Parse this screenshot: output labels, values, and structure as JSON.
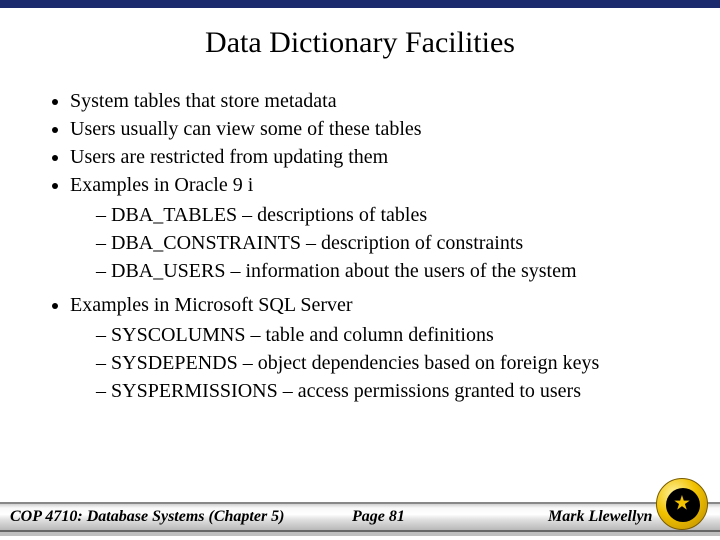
{
  "title": "Data Dictionary Facilities",
  "bullets": [
    {
      "text": "System tables that store metadata"
    },
    {
      "text": "Users usually can view some of these tables"
    },
    {
      "text": "Users are restricted from updating them"
    },
    {
      "text": "Examples in Oracle 9 i",
      "sub": [
        "DBA_TABLES – descriptions of tables",
        "DBA_CONSTRAINTS – description of constraints",
        "DBA_USERS – information about the users of the system"
      ]
    },
    {
      "text": "Examples in Microsoft SQL Server",
      "sub": [
        "SYSCOLUMNS – table and column definitions",
        "SYSDEPENDS – object dependencies based on foreign keys",
        "SYSPERMISSIONS – access permissions granted to users"
      ]
    }
  ],
  "footer": {
    "course": "COP 4710: Database Systems  (Chapter 5)",
    "page": "Page 81",
    "author": "Mark Llewellyn"
  }
}
